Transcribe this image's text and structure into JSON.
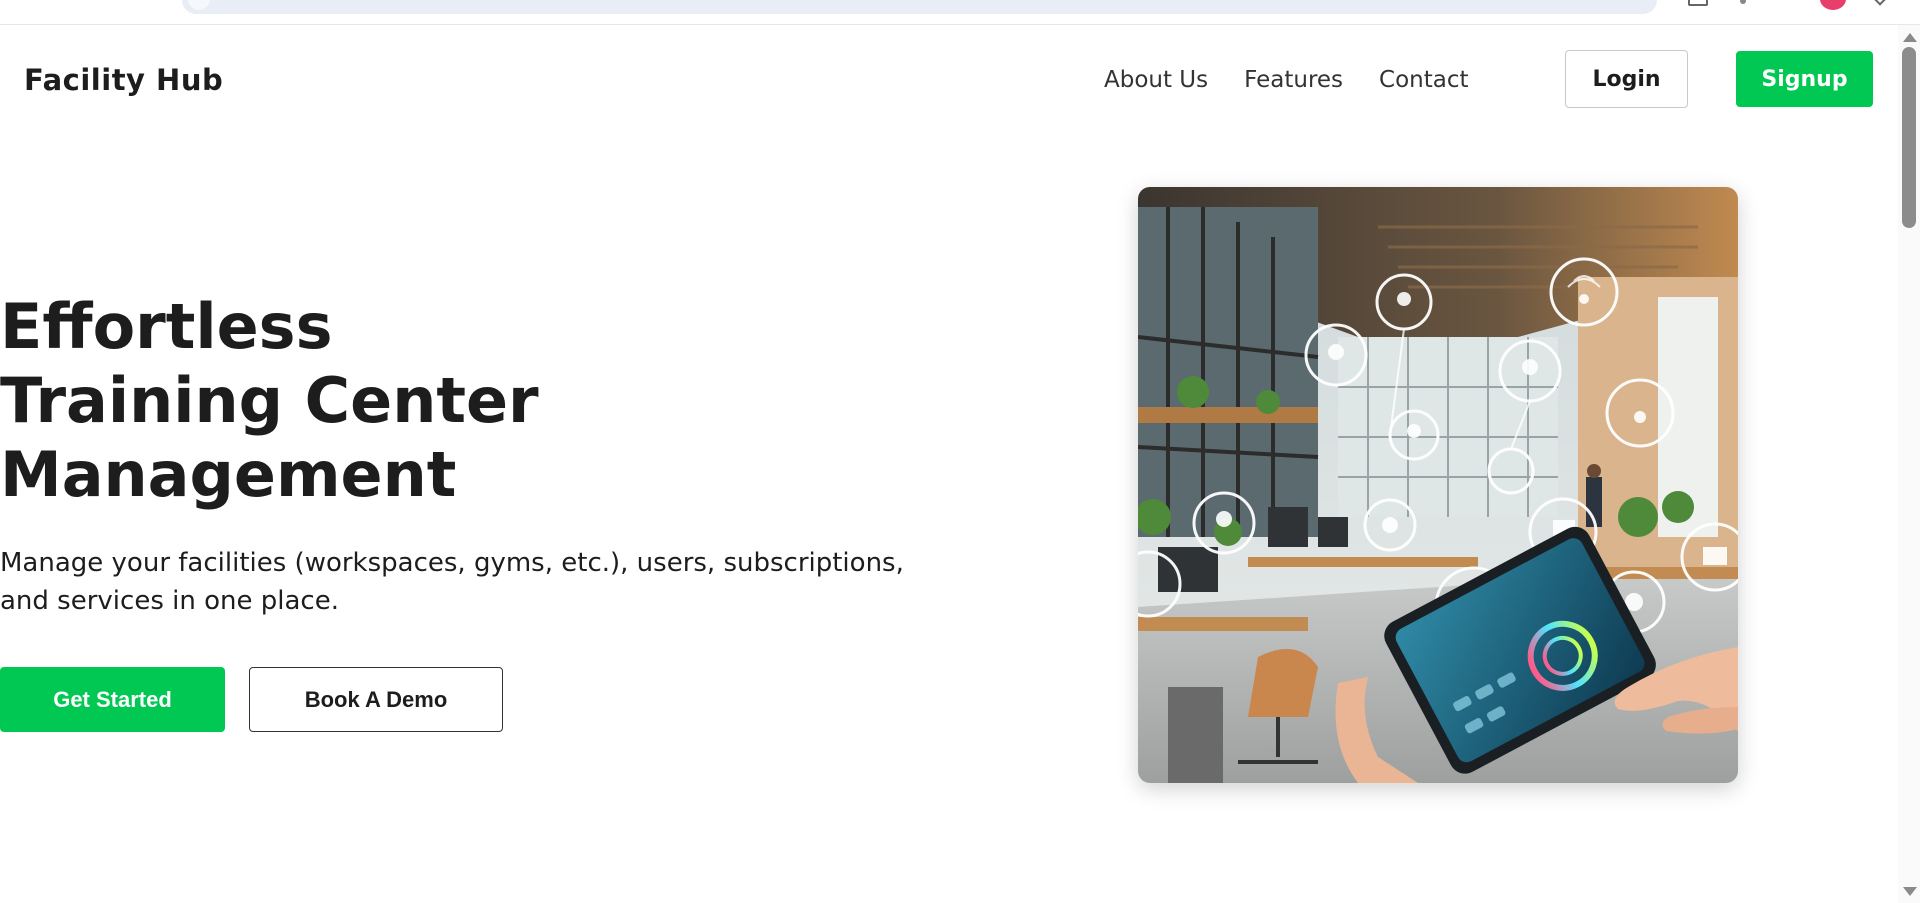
{
  "nav": {
    "brand": "Facility Hub",
    "links": [
      "About Us",
      "Features",
      "Contact"
    ],
    "login_label": "Login",
    "signup_label": "Signup"
  },
  "hero": {
    "title_lines": [
      "Effortless",
      "Training Center",
      "Management"
    ],
    "description": "Manage your facilities (workspaces, gyms, etc.), users, subscriptions, and services in one place.",
    "primary_cta": "Get Started",
    "secondary_cta": "Book A Demo"
  },
  "colors": {
    "accent": "#00c853",
    "text": "#1d1d1d",
    "profile": "#e83e6c"
  }
}
